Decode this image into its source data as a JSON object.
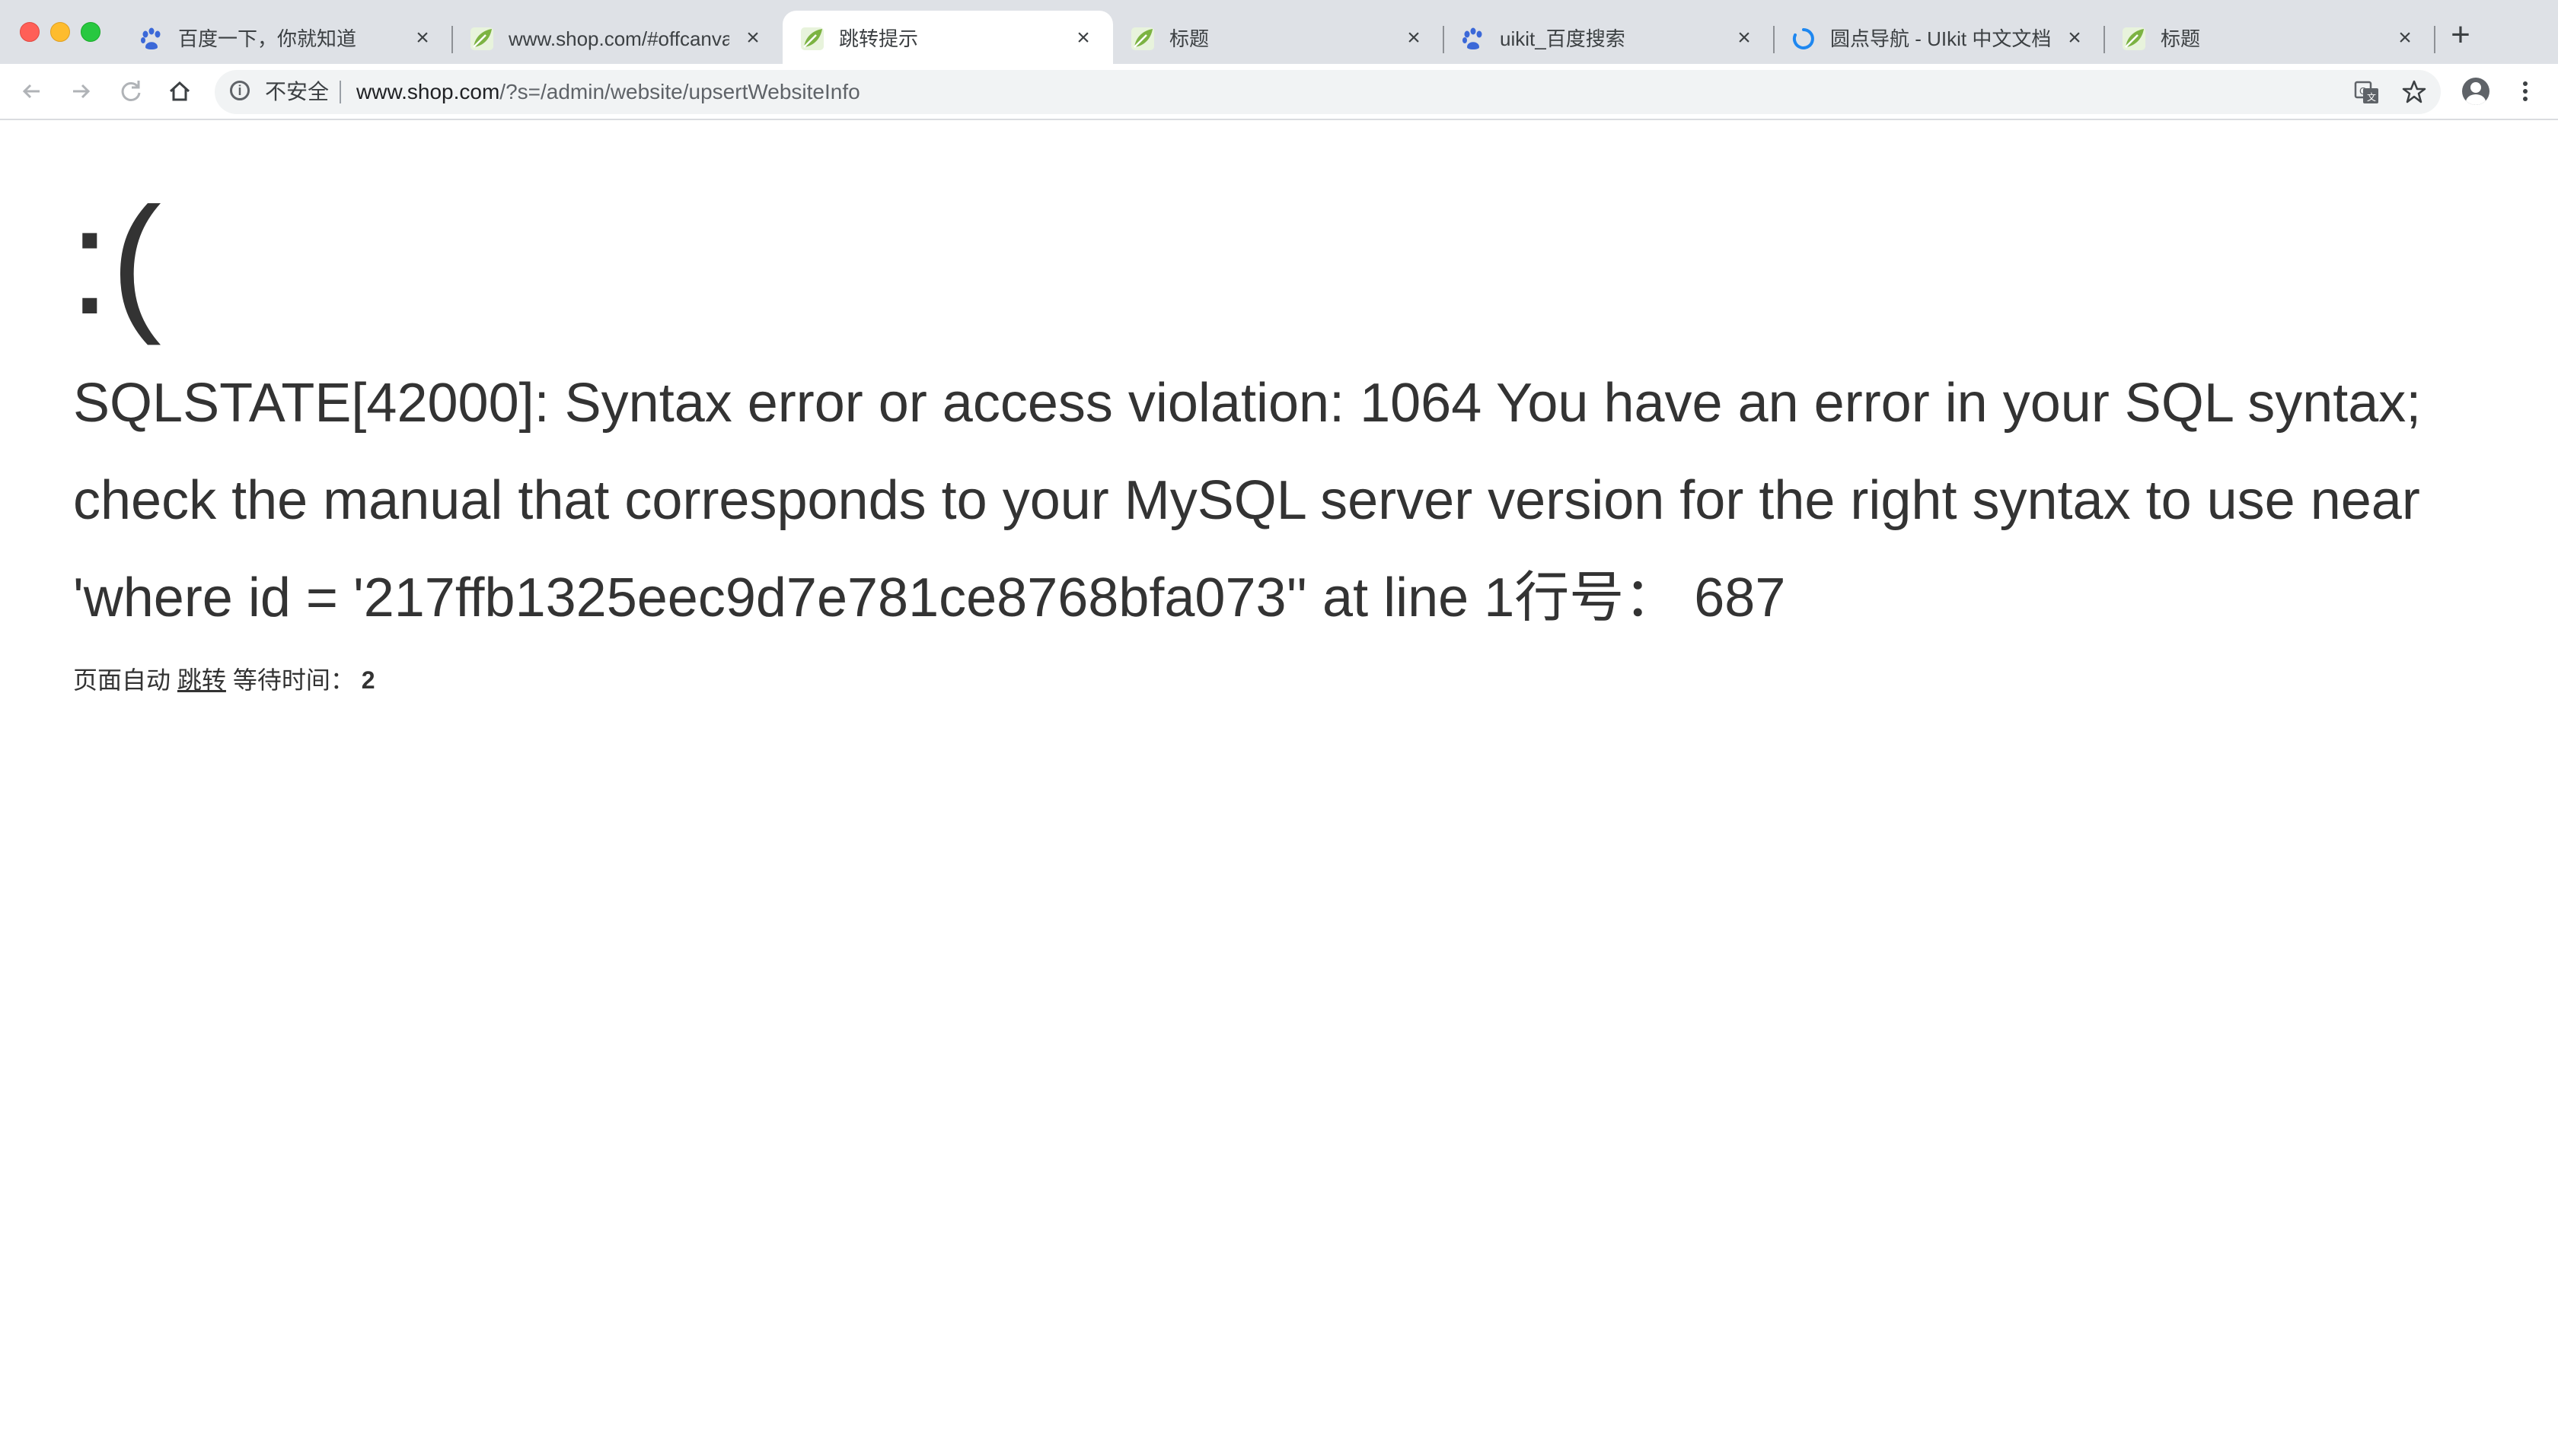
{
  "browser": {
    "tabs": [
      {
        "title": "百度一下，你就知道",
        "favicon": "baidu-paw-icon",
        "active": false
      },
      {
        "title": "www.shop.com/#offcanvas",
        "favicon": "leaf-icon",
        "active": false
      },
      {
        "title": "跳转提示",
        "favicon": "leaf-icon",
        "active": true
      },
      {
        "title": "标题",
        "favicon": "leaf-icon",
        "active": false
      },
      {
        "title": "uikit_百度搜索",
        "favicon": "baidu-paw-icon",
        "active": false
      },
      {
        "title": "圆点导航 - UIkit 中文文档",
        "favicon": "uikit-spinner-icon",
        "active": false
      },
      {
        "title": "标题",
        "favicon": "leaf-icon",
        "active": false
      }
    ],
    "close_glyph": "×",
    "new_tab_glyph": "+",
    "security_label": "不安全",
    "url_host": "www.shop.com",
    "url_path": "/?s=/admin/website/upsertWebsiteInfo"
  },
  "page": {
    "face": ":(",
    "error_message": "SQLSTATE[42000]: Syntax error or access violation: 1064 You have an error in your SQL syntax; check the manual that corresponds to your MySQL server version for the right syntax to use near 'where id = '217ffb1325eec9d7e781ce8768bfa073'' at line 1行号： 687",
    "auto_prefix": "页面自动",
    "jump_link": "跳转",
    "wait_label": "等待时间：",
    "wait_seconds": "2"
  }
}
